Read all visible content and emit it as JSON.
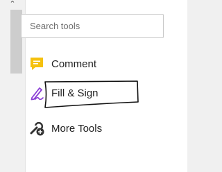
{
  "search": {
    "placeholder": "Search tools"
  },
  "tools": [
    {
      "label": "Comment",
      "icon": "comment-icon",
      "color": "#f5c10e"
    },
    {
      "label": "Fill & Sign",
      "icon": "fill-sign-icon",
      "color": "#8b3fd6"
    },
    {
      "label": "More Tools",
      "icon": "more-tools-icon",
      "color": "#333333"
    }
  ]
}
